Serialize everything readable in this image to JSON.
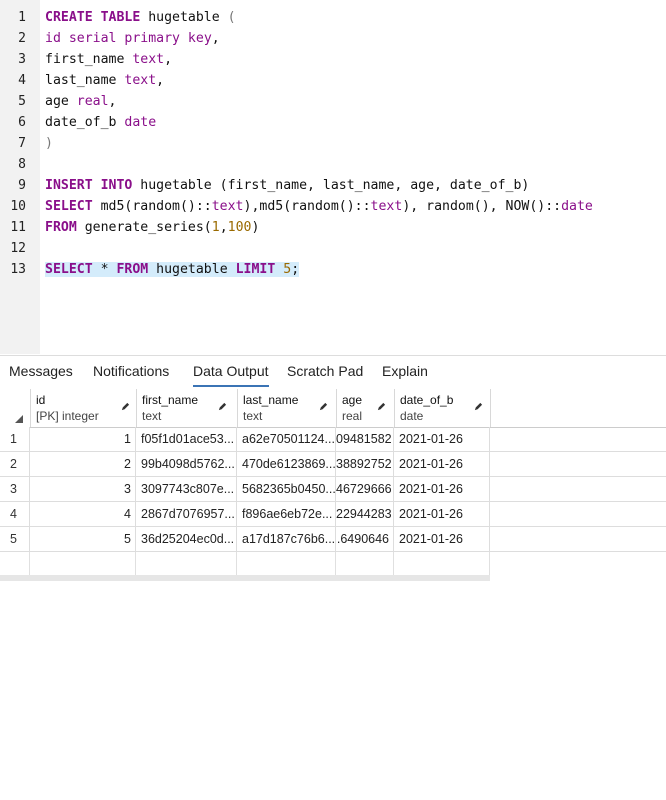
{
  "editor": {
    "line_numbers": [
      "1",
      "2",
      "3",
      "4",
      "5",
      "6",
      "7",
      "8",
      "9",
      "10",
      "11",
      "12",
      "13"
    ]
  },
  "tabs": [
    {
      "label": "Messages"
    },
    {
      "label": "Notifications"
    },
    {
      "label": "Data Output"
    },
    {
      "label": "Scratch Pad"
    },
    {
      "label": "Explain"
    }
  ],
  "grid": {
    "columns": [
      {
        "name": "id",
        "type": "[PK] integer"
      },
      {
        "name": "first_name",
        "type": "text"
      },
      {
        "name": "last_name",
        "type": "text"
      },
      {
        "name": "age",
        "type": "real"
      },
      {
        "name": "date_of_b",
        "type": "date"
      }
    ],
    "rows": [
      {
        "n": "1",
        "id": "1",
        "first_name": "f05f1d01ace53...",
        "last_name": "a62e70501124...",
        "age": "09481582",
        "date": "2021-01-26"
      },
      {
        "n": "2",
        "id": "2",
        "first_name": "99b4098d5762...",
        "last_name": "470de6123869...",
        "age": "38892752",
        "date": "2021-01-26"
      },
      {
        "n": "3",
        "id": "3",
        "first_name": "3097743c807e...",
        "last_name": "5682365b0450...",
        "age": "46729666",
        "date": "2021-01-26"
      },
      {
        "n": "4",
        "id": "4",
        "first_name": "2867d7076957...",
        "last_name": "f896ae6eb72e...",
        "age": "22944283",
        "date": "2021-01-26"
      },
      {
        "n": "5",
        "id": "5",
        "first_name": "36d25204ec0d...",
        "last_name": "a17d187c76b6...",
        "age": ".6490646",
        "date": "2021-01-26"
      }
    ]
  },
  "sql": {
    "l1_kw": "CREATE TABLE",
    "l1_rest": " hugetable ",
    "l1_paren": "(",
    "l2_col": "id",
    "l2_type": "serial primary key",
    "l3": "first_name ",
    "l3_type": "text",
    "l4": "last_name ",
    "l4_type": "text",
    "l5": "age ",
    "l5_type": "real",
    "l6": "date_of_b ",
    "l6_type": "date",
    "l7": ")",
    "l9_kw": "INSERT INTO",
    "l9_rest": " hugetable (first_name, last_name, age, date_of_b)",
    "l10_kw": "SELECT",
    "l10_a": " md5(random()::",
    "l10_t1": "text",
    "l10_b": "),md5(random()::",
    "l10_t2": "text",
    "l10_c": "), random(), NOW()::",
    "l10_t3": "date",
    "l11_kw": "FROM",
    "l11_a": " generate_series(",
    "l11_n1": "1",
    "l11_b": ",",
    "l11_n2": "100",
    "l11_c": ")",
    "l13_kw1": "SELECT",
    "l13_a": " * ",
    "l13_kw2": "FROM",
    "l13_b": " hugetable ",
    "l13_kw3": "LIMIT",
    "l13_c": " ",
    "l13_n": "5",
    "l13_d": ";"
  },
  "colors": {
    "keyword": "#8a0f8a",
    "number": "#9a6a00",
    "highlight": "#d4ecfb",
    "tab_underline": "#3b74b5"
  }
}
